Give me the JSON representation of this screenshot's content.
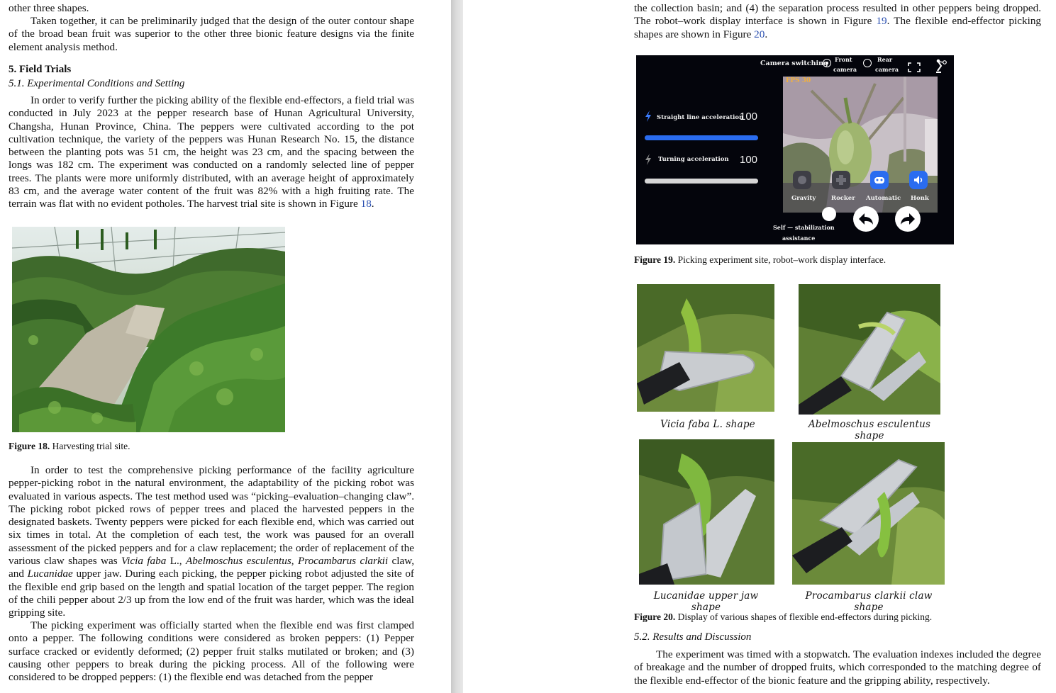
{
  "left": {
    "intro_line": "other three shapes.",
    "para_contour": "Taken together, it can be preliminarily judged that the design of the outer contour shape of the broad bean fruit was superior to the other three bionic feature designs via the finite element analysis method.",
    "section_title": "5. Field Trials",
    "subsection_title": "5.1. Experimental Conditions and Setting",
    "para_field_1": "In order to verify further the picking ability of the flexible end-effectors, a field trial was conducted in July 2023 at the pepper research base of Hunan Agricultural University, Changsha, Hunan Province, China.  The peppers were cultivated according to the pot cultivation technique, the variety of the peppers was Hunan Research No. 15, the distance between the planting pots was 51 cm, the height was 23 cm, and the spacing between the longs was 182 cm. The experiment was conducted on a randomly selected line of pepper trees. The plants were more uniformly distributed, with an average height of approximately 83 cm, and the average water content of the fruit was 82% with a high fruiting rate. The terrain was flat with no evident potholes. The harvest trial site is shown in Figure ",
    "fig18_ref": "18",
    "fig18_caption_label": "Figure 18.",
    "fig18_caption_text": " Harvesting trial site.",
    "para_test_1": "In order to test the comprehensive picking performance of the facility agriculture pepper-picking robot in the natural environment, the adaptability of the picking robot was evaluated in various aspects. The test method used was “picking–evaluation–changing claw”. The picking robot picked rows of pepper trees and placed the harvested peppers in the designated baskets.  Twenty peppers were picked for each flexible end, which was carried out six times in total.  At the completion of each test, the work was paused for an overall assessment of the picked peppers and for a claw replacement; the order of replacement of the various claw shapes was ",
    "sp_vicia": "Vicia faba",
    "sp_vicia_suffix": " L., ",
    "sp_abel": "Abelmoschus esculentus",
    "sep_1": ", ",
    "sp_proc": "Procambarus clarkii",
    "txt_claw_and": " claw, and ",
    "sp_luc": "Lucanidae",
    "para_test_2": " upper jaw.  During each picking, the pepper picking robot adjusted the site of the flexible end grip based on the length and spatial location of the target pepper. The region of the chili pepper about 2/3 up from the low end of the fruit was harder, which was the ideal gripping site.",
    "para_broken": "The picking experiment was officially started when the flexible end was first clamped onto a pepper. The following conditions were considered as broken peppers: (1) Pepper surface cracked or evidently deformed; (2) pepper fruit stalks mutilated or broken; and (3) causing other peppers to break during the picking process. All of the following were considered to be dropped peppers:  (1) the flexible end was detached from the pepper"
  },
  "right": {
    "para_top_a": "the collection basin; and (4) the separation process resulted in other peppers being dropped. The robot–work display interface is shown in Figure ",
    "fig19_ref": "19",
    "para_top_b": ". The flexible end-effector picking shapes are shown in Figure ",
    "fig20_ref": "20",
    "para_top_c": ".",
    "fig19_caption_label": "Figure 19.",
    "fig19_caption_text": " Picking experiment site, robot–work display interface.",
    "sub_labels": [
      "Vicia faba L. shape",
      "Abelmoschus esculentus shape",
      "Lucanidae upper jaw shape",
      "Procambarus clarkii claw shape"
    ],
    "fig20_caption_label": "Figure 20.",
    "fig20_caption_text": " Display of various shapes of flexible end-effectors during picking.",
    "subsection_title": "5.2. Results and Discussion",
    "para_results": "The experiment was timed with a stopwatch. The evaluation indexes included the degree of breakage and the number of dropped fruits, which corresponded to the matching degree of the flexible end-effector of the bionic feature and the gripping ability, respectively."
  },
  "ui": {
    "camera_switching": "Camera switching",
    "front_camera_1": "Front",
    "front_camera_2": "camera",
    "rear_camera_1": "Rear",
    "rear_camera_2": "camera",
    "fps": "FPS 30",
    "straight_label": "Straight line acceleration",
    "straight_value": "100",
    "turning_label": "Turning acceleration",
    "turning_value": "100",
    "mode_gravity": "Gravity",
    "mode_rocker": "Rocker",
    "mode_automatic": "Automatic",
    "mode_honk": "Honk",
    "self_stab_1": "Self — stabilization",
    "self_stab_2": "assistance",
    "straight_level": 1.0,
    "turning_level": 1.0,
    "accent_blue": "#2a6cf0",
    "icons": [
      "lightning-icon",
      "fullscreen-icon",
      "robot-arm-icon",
      "gamepad-icon",
      "speaker-icon",
      "undo-arrow-icon",
      "redo-arrow-icon"
    ]
  }
}
